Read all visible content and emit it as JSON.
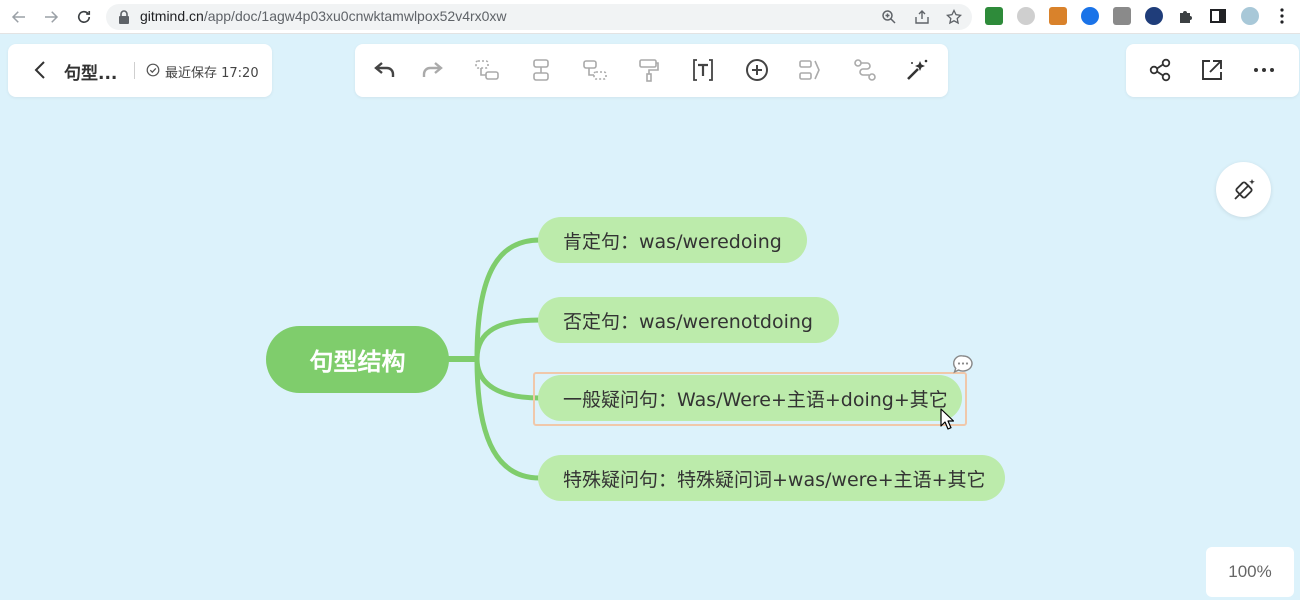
{
  "browser": {
    "url_host": "gitmind.cn",
    "url_path": "/app/doc/1agw4p03xu0cnwktamwlpox52v4rx0xw"
  },
  "header": {
    "doc_title": "句型...",
    "save_status": "最近保存 17:20"
  },
  "mindmap": {
    "root": "句型结构",
    "branches": [
      {
        "label": "肯定句：was/weredoing"
      },
      {
        "label": "否定句：was/werenotdoing"
      },
      {
        "label": "一般疑问句：Was/Were+主语+doing+其它"
      },
      {
        "label": "特殊疑问句：特殊疑问词+was/were+主语+其它"
      }
    ]
  },
  "zoom_level": "100%",
  "colors": {
    "canvas_bg": "#dcf2fb",
    "root_fill": "#7fcd6c",
    "branch_fill": "#bcebab",
    "connector": "#7fcd6c",
    "selection": "#f0c8aa"
  },
  "icons": {
    "toolbar": [
      "undo-icon",
      "redo-icon",
      "add-child-node-icon",
      "add-sibling-node-icon",
      "add-parent-node-icon",
      "format-painter-icon",
      "text-style-icon",
      "insert-icon",
      "summary-icon",
      "relation-line-icon",
      "ai-magic-icon"
    ],
    "right": [
      "share-icon",
      "export-icon",
      "more-icon"
    ]
  }
}
